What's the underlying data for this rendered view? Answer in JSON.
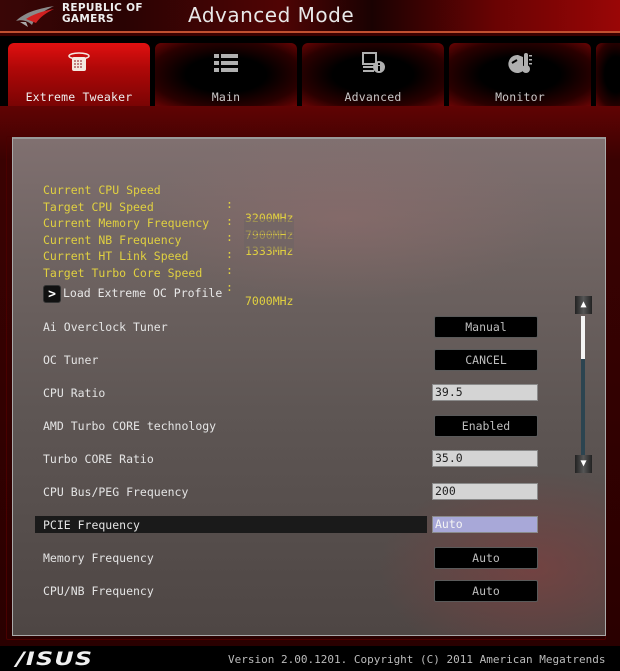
{
  "header": {
    "brand_line1": "REPUBLIC OF",
    "brand_line2": "GAMERS",
    "title": "Advanced Mode"
  },
  "tabs": [
    {
      "label": "Extreme Tweaker",
      "icon": "tweaker-icon",
      "active": true
    },
    {
      "label": "Main",
      "icon": "list-icon",
      "active": false
    },
    {
      "label": "Advanced",
      "icon": "advanced-info-icon",
      "active": false
    },
    {
      "label": "Monitor",
      "icon": "monitor-gauge-icon",
      "active": false
    }
  ],
  "info": [
    {
      "label": "Current CPU Speed",
      "colon": ":",
      "value": "3200MHz"
    },
    {
      "label": "Target CPU Speed",
      "colon": ":",
      "value": "7900MHz"
    },
    {
      "label": "Current Memory Frequency",
      "colon": ":",
      "value": "1333MHz"
    },
    {
      "label": "Current NB Frequency",
      "colon": ":",
      "value": ""
    },
    {
      "label": "Current HT Link Speed",
      "colon": ":",
      "value": ""
    },
    {
      "label": "Target Turbo Core Speed",
      "colon": ":",
      "value": "7000MHz"
    }
  ],
  "load_profile": {
    "arrow": ">",
    "label": "Load Extreme OC Profile"
  },
  "settings": [
    {
      "label": "Ai Overclock Tuner",
      "type": "button",
      "value": "Manual"
    },
    {
      "label": "OC Tuner",
      "type": "button",
      "value": "CANCEL"
    },
    {
      "label": "CPU Ratio",
      "type": "input",
      "value": "39.5"
    },
    {
      "label": "AMD Turbo CORE technology",
      "type": "button",
      "value": "Enabled"
    },
    {
      "label": "Turbo CORE Ratio",
      "type": "input",
      "value": "35.0"
    },
    {
      "label": "CPU Bus/PEG Frequency",
      "type": "input",
      "value": "200"
    },
    {
      "label": "PCIE Frequency",
      "type": "input",
      "value": "Auto",
      "selected": true
    },
    {
      "label": "Memory Frequency",
      "type": "button",
      "value": "Auto"
    },
    {
      "label": "CPU/NB Frequency",
      "type": "button",
      "value": "Auto"
    }
  ],
  "scrollbar": {
    "up": "▲",
    "down": "▼",
    "position": 0.0,
    "visible_fraction": 0.31
  },
  "footer": {
    "logo": "/ISUS",
    "version": "Version 2.00.1201. Copyright (C) 2011 American Megatrends"
  },
  "colors": {
    "accent_red": "#c00808",
    "info_yellow": "#e0d040",
    "selected_input": "#a8a8d8"
  }
}
